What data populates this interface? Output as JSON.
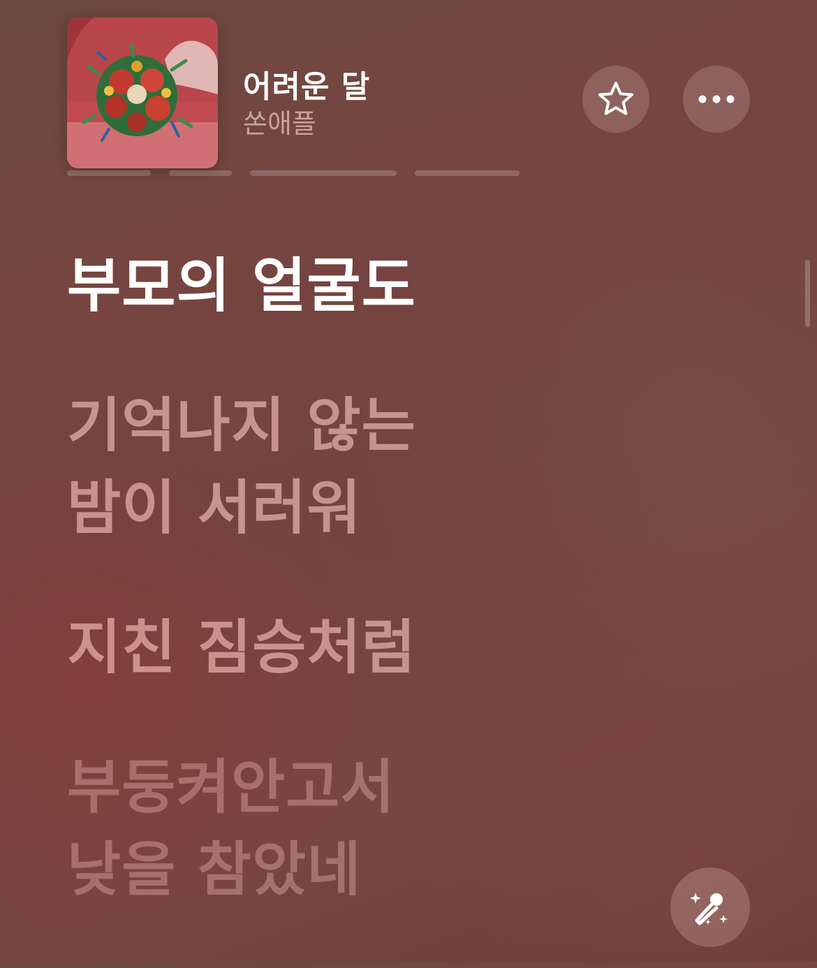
{
  "now_playing": {
    "title": "어려운 달",
    "artist": "쏜애플"
  },
  "actions": {
    "favorite_icon": "star-outline-icon",
    "more_icon": "ellipsis-icon",
    "sing_icon": "microphone-sparkles-icon"
  },
  "lyrics": {
    "current": "부모의 얼굴도",
    "upcoming": [
      {
        "lines": [
          "기억나지 않는",
          "밤이 서러워"
        ]
      },
      {
        "lines": [
          "지친 짐승처럼"
        ]
      },
      {
        "lines": [
          "부둥켜안고서",
          "낮을 참았네"
        ]
      }
    ]
  },
  "colors": {
    "background": "#74433f",
    "current_lyric": "#ffffff",
    "upcoming_lyric": "#f5c8c3"
  }
}
